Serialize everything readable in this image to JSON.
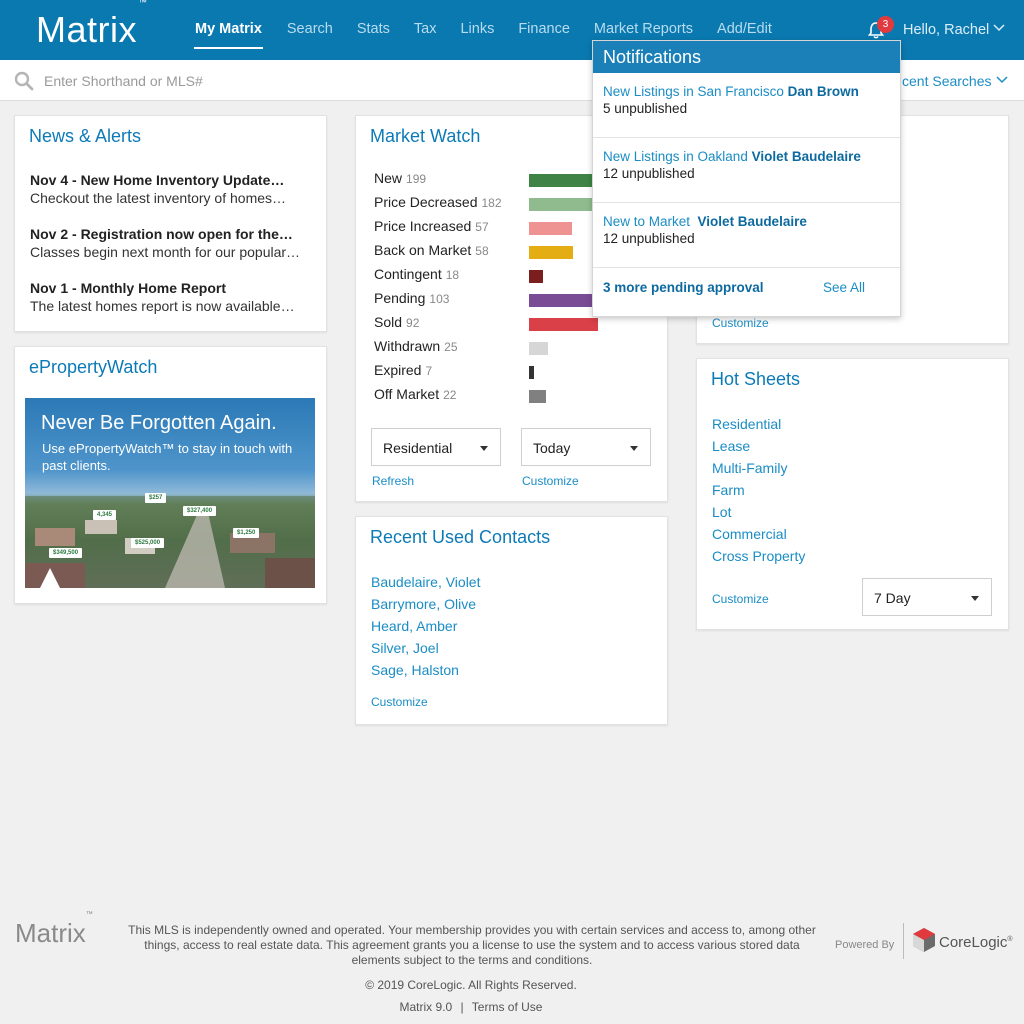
{
  "header": {
    "logo": "Matrix",
    "logo_tm": "™",
    "nav": [
      "My Matrix",
      "Search",
      "Stats",
      "Tax",
      "Links",
      "Finance",
      "Market Reports",
      "Add/Edit"
    ],
    "notification_count": "3",
    "greeting": "Hello, Rachel",
    "brand_color": "#0a79b0"
  },
  "search": {
    "placeholder": "Enter Shorthand or MLS#",
    "recent_label": "cent Searches"
  },
  "news": {
    "title": "News & Alerts",
    "items": [
      {
        "headline": "Nov 4 - New Home Inventory Update…",
        "body": "Checkout the latest inventory of homes…"
      },
      {
        "headline": "Nov 2 - Registration now open for the…",
        "body": "Classes begin next month for our popular…"
      },
      {
        "headline": "Nov 1 - Monthly Home Report",
        "body": "The latest homes report is now available…"
      }
    ]
  },
  "epw": {
    "title": "ePropertyWatch",
    "banner_headline": "Never Be Forgotten Again.",
    "banner_sub": "Use ePropertyWatch™ to stay in touch with past clients.",
    "tags": [
      "$257",
      "$327,400",
      "4,345",
      "$1,250",
      "$349,500",
      "$525,000"
    ]
  },
  "market_watch": {
    "title": "Market Watch",
    "rows": [
      {
        "label": "New",
        "count": "199",
        "value": 199,
        "color": "#3f8446"
      },
      {
        "label": "Price Decreased",
        "count": "182",
        "value": 182,
        "color": "#8fbb8f"
      },
      {
        "label": "Price Increased",
        "count": "57",
        "value": 57,
        "color": "#ee9292"
      },
      {
        "label": "Back on Market",
        "count": "58",
        "value": 58,
        "color": "#e5ad14"
      },
      {
        "label": "Contingent",
        "count": "18",
        "value": 18,
        "color": "#7a1e1e"
      },
      {
        "label": "Pending",
        "count": "103",
        "value": 103,
        "color": "#7a4c96"
      },
      {
        "label": "Sold",
        "count": "92",
        "value": 92,
        "color": "#d94048"
      },
      {
        "label": "Withdrawn",
        "count": "25",
        "value": 25,
        "color": "#d6d6d6"
      },
      {
        "label": "Expired",
        "count": "7",
        "value": 7,
        "color": "#333333"
      },
      {
        "label": "Off Market",
        "count": "22",
        "value": 22,
        "color": "#808080"
      }
    ],
    "property_type": "Residential",
    "period": "Today",
    "refresh_label": "Refresh",
    "customize_label": "Customize"
  },
  "contacts": {
    "title": "Recent Used Contacts",
    "items": [
      "Baudelaire, Violet",
      "Barrymore, Olive",
      "Heard, Amber",
      "Silver, Joel",
      "Sage, Halston"
    ],
    "customize_label": "Customize"
  },
  "hidden_card": {
    "customize_label": "Customize"
  },
  "hot_sheets": {
    "title": "Hot Sheets",
    "items": [
      "Residential",
      "Lease",
      "Multi-Family",
      "Farm",
      "Lot",
      "Commercial",
      "Cross Property"
    ],
    "customize_label": "Customize",
    "period": "7 Day"
  },
  "notifications": {
    "title": "Notifications",
    "items": [
      {
        "text": "New Listings in San Francisco",
        "person": "Dan Brown",
        "sub": "5 unpublished"
      },
      {
        "text": "New Listings in Oakland",
        "person": "Violet Baudelaire",
        "sub": "12 unpublished"
      },
      {
        "text": "New to Market",
        "person": "Violet Baudelaire",
        "sub": "12 unpublished"
      }
    ],
    "pending": "3 more pending approval",
    "see_all": "See All"
  },
  "footer": {
    "logo": "Matrix",
    "logo_tm": "™",
    "disclaimer": "This MLS is independently owned and operated. Your membership provides you with certain services and access to, among other things, access to real estate data. This agreement grants you a license to use the system and to access various stored data elements subject to the terms and conditions.",
    "copyright": "© 2019 CoreLogic. All Rights Reserved.",
    "version": "Matrix 9.0",
    "separator": "|",
    "terms": "Terms of Use",
    "powered_by": "Powered By",
    "brand": "CoreLogic",
    "brand_mark": "®"
  }
}
